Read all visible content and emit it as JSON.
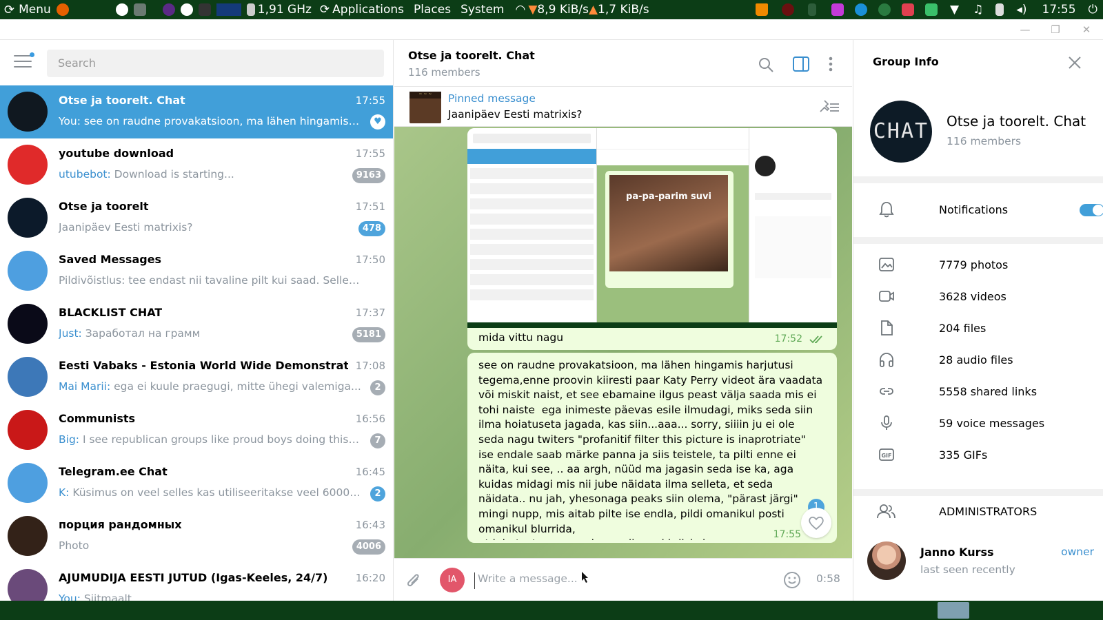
{
  "system_bar": {
    "menu_label": "Menu",
    "cpu": "1,91 GHz",
    "applications": "Applications",
    "places": "Places",
    "system": "System",
    "net_down": "8,9 KiB/s",
    "net_up": "1,7 KiB/s",
    "clock": "17:55"
  },
  "sidebar": {
    "search_placeholder": "Search",
    "chats": [
      {
        "title": "Otse ja toorelt. Chat",
        "time": "17:55",
        "sender": "You:",
        "preview": " see on raudne provakatsioon, ma lähen hingamis ha...",
        "badge": "",
        "active": true
      },
      {
        "title": "youtube download",
        "time": "17:55",
        "sender": "utubebot:",
        "preview": " Download is starting...",
        "badge": "9163"
      },
      {
        "title": "Otse ja toorelt",
        "time": "17:51",
        "sender": "",
        "preview": "Jaanipäev Eesti matrixis?",
        "badge": "478"
      },
      {
        "title": "Saved Messages",
        "time": "17:50",
        "sender": "",
        "preview": "Pildivõistlus: tee endast nii tavaline pilt kui saad. Sellest mi...",
        "badge": ""
      },
      {
        "title": "BLACKLIST CHAT",
        "time": "17:37",
        "sender": "Just:",
        "preview": " Заработал на грамм",
        "badge": "5181"
      },
      {
        "title": "Eesti Vabaks - Estonia World Wide Demonstrati...",
        "time": "17:08",
        "sender": "Mai Marii:",
        "preview": " ega ei kuule praegugi, mitte ühegi valemiga...",
        "badge": "2"
      },
      {
        "title": "Communists",
        "time": "16:56",
        "sender": "Big:",
        "preview": " I see republican groups like proud boys doing this, bu...",
        "badge": "7"
      },
      {
        "title": "Telegram.ee Chat",
        "time": "16:45",
        "sender": "K:",
        "preview": " Küsimus on veel selles kas utiliseeritakse veel 60000 ah...",
        "badge": "2"
      },
      {
        "title": "порция рандомных",
        "time": "16:43",
        "sender": "",
        "preview": "Photo",
        "badge": "4006"
      },
      {
        "title": "AJUMUDIJA EESTI JUTUD (Igas-Keeles, 24/7)",
        "time": "16:20",
        "sender": "You:",
        "preview": " Siitmaalt",
        "badge": ""
      }
    ]
  },
  "chat": {
    "title": "Otse ja toorelt. Chat",
    "subtitle": "116 members",
    "pinned_label": "Pinned message",
    "pinned_text": "Jaanipäev Eesti matrixis?",
    "msg1_text": "mida vittu nagu",
    "msg1_time": "17:52",
    "msg2_text": "see on raudne provakatsioon, ma lähen hingamis harjutusi tegema,enne proovin kiiresti paar Katy Perry videot ära vaadata või miskit naist, et see ebamaine ilgus peast välja saada mis ei tohi naiste  ega inimeste päevas esile ilmudagi, miks seda siin ilma hoiatuseta jagada, kas siin...aaa... sorry, siiiin ju ei ole seda nagu twiters \"profanitif filter this picture is inaprotriate\" ise endale saab märke panna ja siis teistele, ta pilti enne ei näita, kui see, .. aa argh, nüüd ma jagasin seda ise ka, aga kuidas midagi mis nii jube näidata ilma selleta, et seda näidata.. nu jah, yhesonaga peaks siin olema, \"pärast järgi\" mingi nupp, mis aitab pilte ise endla, pildi omanikul posti omanikul blurrida,\net jubetuste promomisena silma ei kriiskaks",
    "msg2_time": "17:55",
    "unread_count": "1",
    "composer_placeholder": "Write a message...",
    "composer_avatar": "IA",
    "voice_time": "0:58",
    "screenshot_caption": "pa-pa-parim suvi"
  },
  "group_info": {
    "header": "Group Info",
    "name": "Otse ja toorelt. Chat",
    "members": "116 members",
    "notifications_label": "Notifications",
    "notifications_on": true,
    "media": [
      {
        "icon": "photo-icon",
        "label": "7779 photos"
      },
      {
        "icon": "video-icon",
        "label": "3628 videos"
      },
      {
        "icon": "file-icon",
        "label": "204 files"
      },
      {
        "icon": "headphones-icon",
        "label": "28 audio files"
      },
      {
        "icon": "link-icon",
        "label": "5558 shared links"
      },
      {
        "icon": "mic-icon",
        "label": "59 voice messages"
      },
      {
        "icon": "gif-icon",
        "label": "335 GIFs"
      }
    ],
    "admins_label": "ADMINISTRATORS",
    "admin_name": "Janno Kurss",
    "admin_status": "last seen recently",
    "admin_role": "owner"
  },
  "colors": {
    "accent": "#419fd9",
    "panel": "#0c3d16",
    "bubble": "#effdde"
  }
}
